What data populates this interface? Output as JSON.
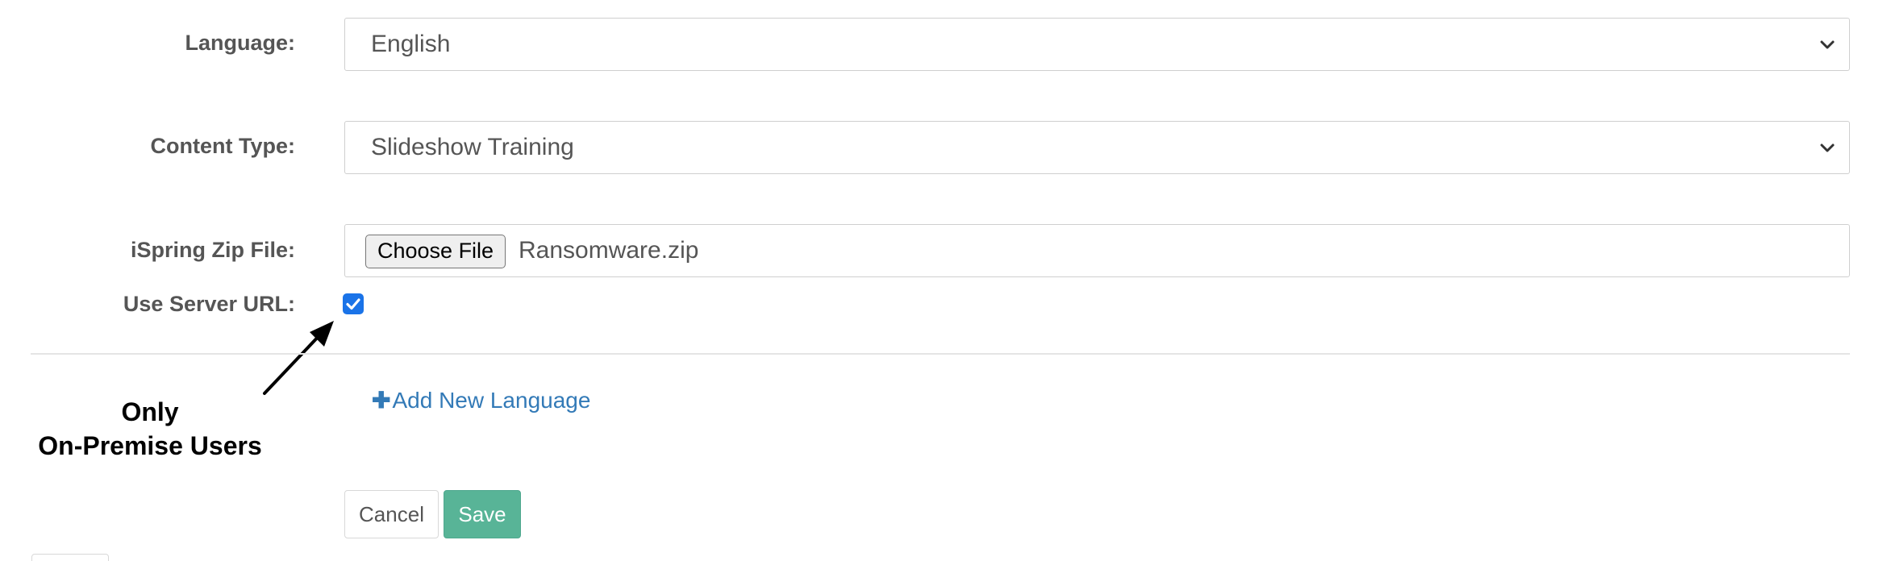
{
  "form": {
    "language": {
      "label": "Language:",
      "value": "English"
    },
    "content_type": {
      "label": "Content Type:",
      "value": "Slideshow Training"
    },
    "zip_file": {
      "label": "iSpring Zip File:",
      "button_label": "Choose File",
      "file_name": "Ransomware.zip"
    },
    "use_server_url": {
      "label": "Use Server URL:",
      "checked": true
    },
    "add_language_label": "Add New Language",
    "add_language_icon": "plus-icon"
  },
  "annotation": {
    "line1": "Only",
    "line2": "On-Premise Users"
  },
  "actions": {
    "cancel_label": "Cancel",
    "save_label": "Save"
  },
  "colors": {
    "accent_blue": "#1a73e8",
    "link_blue": "#337ab7",
    "save_green": "#58b497"
  }
}
